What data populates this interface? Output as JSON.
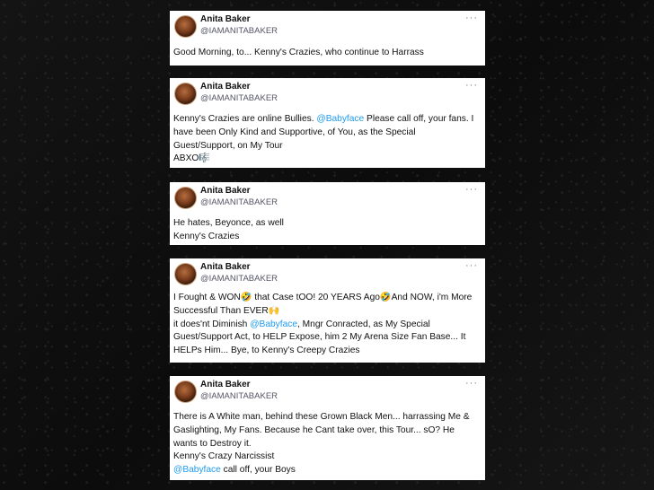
{
  "tweets": [
    {
      "name": "Anita Baker",
      "handle": "@IAMANITABAKER",
      "lines": [
        [
          {
            "t": "Good Morning, to... Kenny's Crazies, who continue to Harrass"
          }
        ]
      ]
    },
    {
      "name": "Anita Baker",
      "handle": "@IAMANITABAKER",
      "lines": [
        [
          {
            "t": "Kenny's Crazies are online Bullies. "
          },
          {
            "t": "@Babyface",
            "m": true
          },
          {
            "t": " Please call off, your fans. I"
          }
        ],
        [
          {
            "t": "have been Only Kind and Supportive, of You, as the Special"
          }
        ],
        [
          {
            "t": "Guest/Support, on My Tour"
          }
        ],
        [
          {
            "t": "ABXO🎼"
          }
        ]
      ]
    },
    {
      "name": "Anita Baker",
      "handle": "@IAMANITABAKER",
      "lines": [
        [
          {
            "t": "He hates, Beyonce, as well"
          }
        ],
        [
          {
            "t": "Kenny's Crazies"
          }
        ]
      ]
    },
    {
      "name": "Anita Baker",
      "handle": "@IAMANITABAKER",
      "lines": [
        [
          {
            "t": "I Fought & WON🤣 that Case tOO! 20 YEARS Ago🤣And NOW, i'm More"
          }
        ],
        [
          {
            "t": "Successful Than EVER🙌"
          }
        ],
        [
          {
            "t": "it does'nt Diminish "
          },
          {
            "t": "@Babyface",
            "m": true
          },
          {
            "t": ", Mngr Conracted, as My Special"
          }
        ],
        [
          {
            "t": "Guest/Support Act, to HELP Expose, him 2 My Arena Size Fan Base... It"
          }
        ],
        [
          {
            "t": "HELPs Him... Bye, to Kenny's Creepy Crazies"
          }
        ]
      ]
    },
    {
      "name": "Anita Baker",
      "handle": "@IAMANITABAKER",
      "lines": [
        [
          {
            "t": "There is A White man, behind these Grown Black Men... harrassing Me &"
          }
        ],
        [
          {
            "t": "Gaslighting, My Fans. Because he Cant take over, this Tour... sO? He"
          }
        ],
        [
          {
            "t": "wants to Destroy it."
          }
        ],
        [
          {
            "t": "Kenny's Crazy Narcissist"
          }
        ],
        [
          {
            "t": "@Babyface",
            "m": true
          },
          {
            "t": " call off, your Boys"
          }
        ]
      ]
    }
  ],
  "more_glyph": "···",
  "colors": {
    "mention": "#1d9bf0",
    "background": "#111111",
    "card": "#ffffff"
  },
  "icons": [
    "avatar",
    "more-options-icon"
  ]
}
